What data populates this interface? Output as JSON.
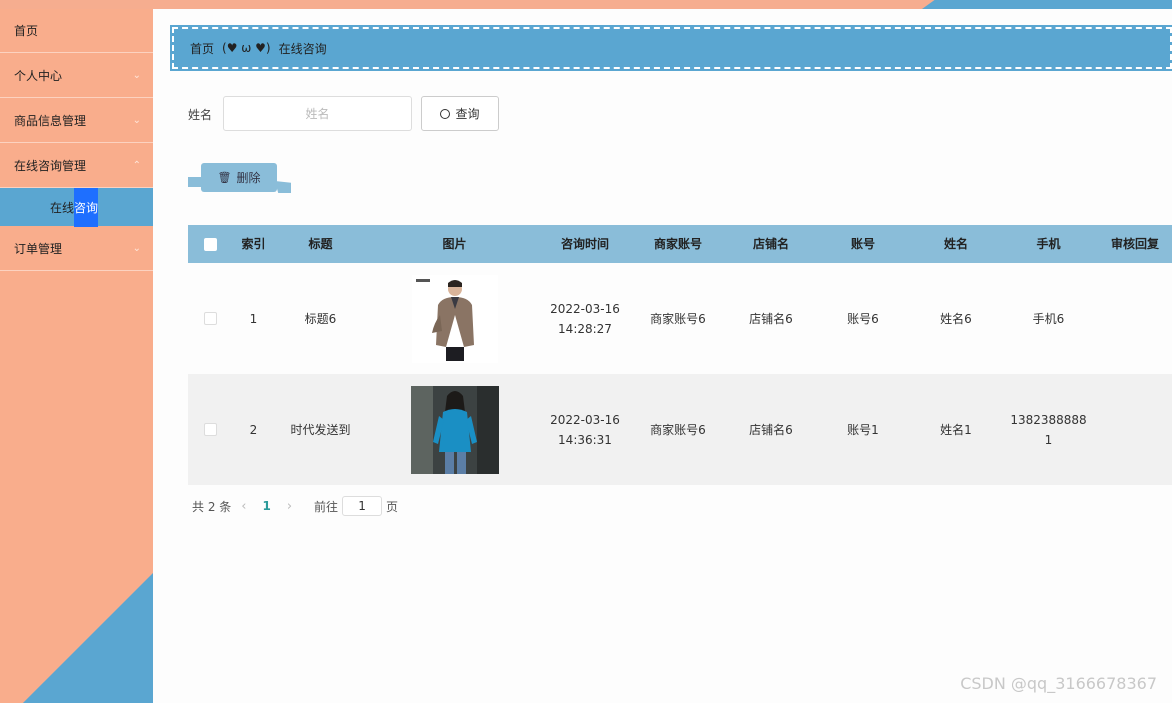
{
  "sidebar": {
    "items": [
      {
        "label": "首页",
        "has_chevron": false
      },
      {
        "label": "个人中心",
        "has_chevron": true
      },
      {
        "label": "商品信息管理",
        "has_chevron": true
      },
      {
        "label": "在线咨询管理",
        "has_chevron": true
      },
      {
        "label": "订单管理",
        "has_chevron": true
      }
    ],
    "sub_item": {
      "label_plain": "在线",
      "label_highlight": "咨询"
    }
  },
  "breadcrumb": {
    "home": "首页",
    "separator": "(♥ ω ♥)",
    "current": "在线咨询"
  },
  "search": {
    "label": "姓名",
    "placeholder": "姓名",
    "value": "",
    "button_label": "查询"
  },
  "delete_button": {
    "label": "删除"
  },
  "table": {
    "headers": [
      "索引",
      "标题",
      "图片",
      "咨询时间",
      "商家账号",
      "店铺名",
      "账号",
      "姓名",
      "手机",
      "审核回复"
    ],
    "rows": [
      {
        "index": "1",
        "title": "标题6",
        "time_date": "2022-03-16",
        "time_clock": "14:28:27",
        "merchant": "商家账号6",
        "shop": "店铺名6",
        "account": "账号6",
        "name": "姓名6",
        "phone_1": "手机6",
        "phone_2": "",
        "review": ""
      },
      {
        "index": "2",
        "title": "时代发送到",
        "time_date": "2022-03-16",
        "time_clock": "14:36:31",
        "merchant": "商家账号6",
        "shop": "店铺名6",
        "account": "账号1",
        "name": "姓名1",
        "phone_1": "1382388888",
        "phone_2": "1",
        "review": ""
      }
    ]
  },
  "pagination": {
    "total_text": "共 2 条",
    "prev": "‹",
    "current_page": "1",
    "next": "›",
    "goto_label": "前往",
    "goto_value": "1",
    "page_suffix": "页"
  },
  "watermark": "CSDN @qq_3166678367",
  "colors": {
    "sidebar": "#f9ad8c",
    "accent_blue": "#5aa6d1",
    "table_header": "#8abdd9",
    "active_highlight": "#1e6fff"
  }
}
